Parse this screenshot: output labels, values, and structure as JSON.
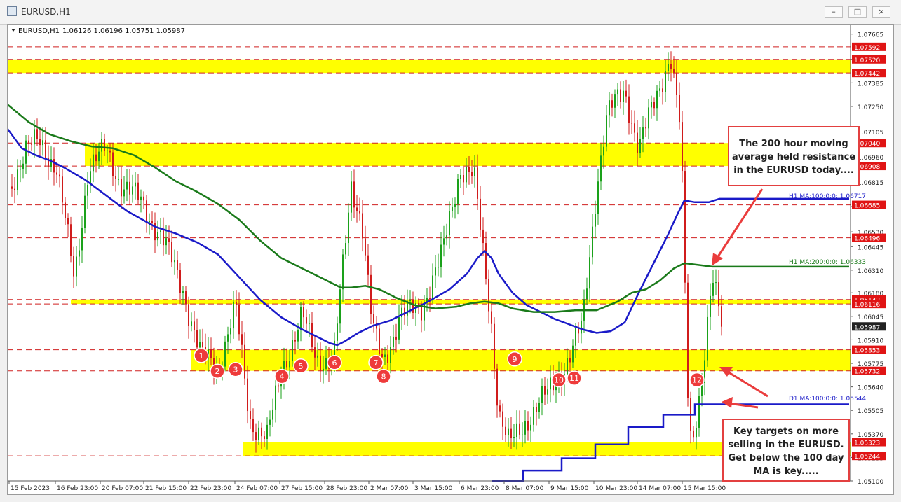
{
  "window": {
    "title": "EURUSD,H1",
    "buttons": [
      "–",
      "□",
      "×"
    ]
  },
  "chart_data": {
    "type": "candlestick",
    "symbol_header": "EURUSD,H1",
    "ohlc_header": "1.06126 1.06196 1.05751 1.05987",
    "y_axis": {
      "range": [
        1.051,
        1.0772
      ],
      "ticks": [
        "1.07665",
        "1.07520",
        "1.07385",
        "1.07250",
        "1.07105",
        "1.06960",
        "1.06815",
        "1.06675",
        "1.06530",
        "1.06445",
        "1.06310",
        "1.06180",
        "1.06045",
        "1.05910",
        "1.05775",
        "1.05640",
        "1.05505",
        "1.05370",
        "1.05235",
        "1.05100"
      ]
    },
    "x_axis": {
      "ticks": [
        "15 Feb 2023",
        "16 Feb 23:00",
        "20 Feb 07:00",
        "21 Feb 15:00",
        "22 Feb 23:00",
        "24 Feb 07:00",
        "27 Feb 15:00",
        "28 Feb 23:00",
        "2 Mar 07:00",
        "3 Mar 15:00",
        "6 Mar 23:00",
        "8 Mar 07:00",
        "9 Mar 15:00",
        "10 Mar 23:00",
        "14 Mar 07:00",
        "15 Mar 15:00"
      ]
    },
    "horizontal_levels": [
      1.07592,
      1.0752,
      1.07442,
      1.0704,
      1.06908,
      1.06685,
      1.06496,
      1.06142,
      1.06116,
      1.05853,
      1.05732,
      1.05323,
      1.05244
    ],
    "price_labels": [
      {
        "value": 1.07592,
        "text": "1.07592"
      },
      {
        "value": 1.0752,
        "text": "1.07520"
      },
      {
        "value": 1.07442,
        "text": "1.07442"
      },
      {
        "value": 1.0704,
        "text": "1.07040"
      },
      {
        "value": 1.06908,
        "text": "1.06908"
      },
      {
        "value": 1.06717,
        "text": "1.06717"
      },
      {
        "value": 1.06685,
        "text": "1.06685"
      },
      {
        "value": 1.06496,
        "text": "1.06496"
      },
      {
        "value": 1.06333,
        "text": "1.06333"
      },
      {
        "value": 1.06142,
        "text": "1.06142"
      },
      {
        "value": 1.06116,
        "text": "1.06116"
      },
      {
        "value": 1.05987,
        "text": "1.05987"
      },
      {
        "value": 1.05853,
        "text": "1.05853"
      },
      {
        "value": 1.05732,
        "text": "1.05732"
      },
      {
        "value": 1.05544,
        "text": "1.05544"
      },
      {
        "value": 1.05323,
        "text": "1.05323"
      },
      {
        "value": 1.05244,
        "text": "1.05244"
      }
    ],
    "zones": [
      {
        "from": 1.07442,
        "to": 1.0752
      },
      {
        "from": 1.06908,
        "to": 1.0704
      },
      {
        "from": 1.06116,
        "to": 1.06142
      },
      {
        "from": 1.05732,
        "to": 1.05853
      },
      {
        "from": 1.05244,
        "to": 1.05323
      }
    ],
    "series": [
      {
        "name": "H1 MA:100:0:0",
        "last": "1.06717",
        "color": "#1a1ac8",
        "points": [
          [
            0,
            1.0712
          ],
          [
            20,
            1.0701
          ],
          [
            40,
            1.0697
          ],
          [
            60,
            1.0694
          ],
          [
            80,
            1.069
          ],
          [
            110,
            1.0683
          ],
          [
            140,
            1.0674
          ],
          [
            170,
            1.0665
          ],
          [
            210,
            1.0656
          ],
          [
            240,
            1.0652
          ],
          [
            270,
            1.0647
          ],
          [
            300,
            1.064
          ],
          [
            330,
            1.0627
          ],
          [
            360,
            1.0614
          ],
          [
            390,
            1.0604
          ],
          [
            420,
            1.0597
          ],
          [
            445,
            1.0592
          ],
          [
            460,
            1.0589
          ],
          [
            470,
            1.0588
          ],
          [
            480,
            1.059
          ],
          [
            500,
            1.0595
          ],
          [
            520,
            1.0599
          ],
          [
            545,
            1.0602
          ],
          [
            570,
            1.0607
          ],
          [
            600,
            1.0613
          ],
          [
            630,
            1.062
          ],
          [
            655,
            1.0629
          ],
          [
            670,
            1.0638
          ],
          [
            680,
            1.0642
          ],
          [
            690,
            1.0638
          ],
          [
            700,
            1.0629
          ],
          [
            720,
            1.0618
          ],
          [
            740,
            1.0611
          ],
          [
            760,
            1.0607
          ],
          [
            780,
            1.0603
          ],
          [
            800,
            1.06
          ],
          [
            820,
            1.0597
          ],
          [
            840,
            1.0595
          ],
          [
            860,
            1.0596
          ],
          [
            880,
            1.0601
          ],
          [
            900,
            1.0618
          ],
          [
            920,
            1.0634
          ],
          [
            940,
            1.065
          ],
          [
            955,
            1.0663
          ],
          [
            965,
            1.0671
          ],
          [
            980,
            1.067
          ],
          [
            1000,
            1.067
          ],
          [
            1015,
            1.0672
          ],
          [
            1200,
            1.0672
          ]
        ]
      },
      {
        "name": "H1 MA:200:0:0",
        "last": "1.06333",
        "color": "#1a7a1a",
        "points": [
          [
            0,
            1.0726
          ],
          [
            30,
            1.0716
          ],
          [
            60,
            1.0709
          ],
          [
            90,
            1.0705
          ],
          [
            120,
            1.0702
          ],
          [
            150,
            1.0701
          ],
          [
            180,
            1.0697
          ],
          [
            210,
            1.069
          ],
          [
            240,
            1.0682
          ],
          [
            270,
            1.0676
          ],
          [
            300,
            1.0669
          ],
          [
            330,
            1.066
          ],
          [
            360,
            1.0648
          ],
          [
            390,
            1.0638
          ],
          [
            420,
            1.0632
          ],
          [
            450,
            1.0626
          ],
          [
            475,
            1.0621
          ],
          [
            490,
            1.0621
          ],
          [
            510,
            1.0622
          ],
          [
            530,
            1.062
          ],
          [
            555,
            1.0615
          ],
          [
            580,
            1.0611
          ],
          [
            610,
            1.0609
          ],
          [
            640,
            1.061
          ],
          [
            660,
            1.0612
          ],
          [
            680,
            1.0613
          ],
          [
            700,
            1.0612
          ],
          [
            720,
            1.0609
          ],
          [
            750,
            1.0607
          ],
          [
            780,
            1.0607
          ],
          [
            810,
            1.0608
          ],
          [
            840,
            1.0608
          ],
          [
            870,
            1.0613
          ],
          [
            890,
            1.0618
          ],
          [
            910,
            1.062
          ],
          [
            930,
            1.0625
          ],
          [
            950,
            1.0632
          ],
          [
            965,
            1.0635
          ],
          [
            985,
            1.0634
          ],
          [
            1005,
            1.0633
          ],
          [
            1200,
            1.0633
          ]
        ]
      },
      {
        "name": "D1 MA:100:0:0",
        "last": "1.05544",
        "color": "#1a1ac8",
        "points": [
          [
            690,
            1.051
          ],
          [
            735,
            1.051
          ],
          [
            735,
            1.0516
          ],
          [
            790,
            1.0516
          ],
          [
            790,
            1.0523
          ],
          [
            838,
            1.0523
          ],
          [
            838,
            1.0531
          ],
          [
            885,
            1.0531
          ],
          [
            885,
            1.0541
          ],
          [
            935,
            1.0541
          ],
          [
            935,
            1.0548
          ],
          [
            980,
            1.0548
          ],
          [
            980,
            1.0554
          ],
          [
            1200,
            1.0554
          ]
        ]
      }
    ],
    "annotations": [
      {
        "type": "callout",
        "text": [
          "The 200 hour moving",
          "average held resistance",
          "in the EURUSD today...."
        ]
      },
      {
        "type": "callout",
        "text": [
          "Key targets on more",
          "selling in the EURUSD.",
          "Get below the 100 day",
          "MA is key....."
        ]
      },
      {
        "type": "markers",
        "labels": [
          "1",
          "2",
          "3",
          "4",
          "5",
          "6",
          "7",
          "8",
          "9",
          "10",
          "11",
          "12"
        ],
        "points": [
          [
            276,
            1.0582
          ],
          [
            299,
            1.0573
          ],
          [
            325,
            1.0574
          ],
          [
            391,
            1.057
          ],
          [
            418,
            1.0576
          ],
          [
            466,
            1.0578
          ],
          [
            525,
            1.0578
          ],
          [
            536,
            1.057
          ],
          [
            723,
            1.058
          ],
          [
            786,
            1.0568
          ],
          [
            808,
            1.0569
          ],
          [
            983,
            1.0568
          ]
        ]
      }
    ]
  }
}
